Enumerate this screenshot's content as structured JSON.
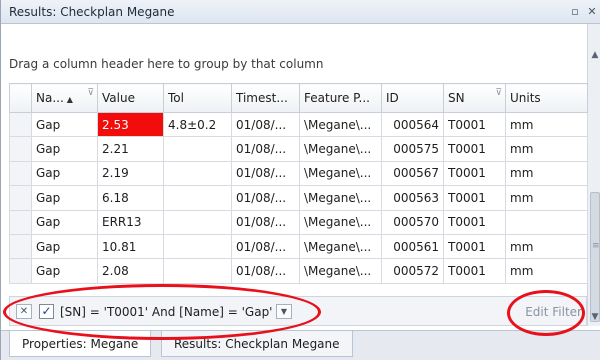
{
  "window": {
    "title": "Results: Checkplan Megane",
    "pin_icon": "dock-icon",
    "close_icon": "close-icon"
  },
  "group_panel": {
    "hint": "Drag a column header here to group by that column"
  },
  "grid": {
    "columns": [
      {
        "label": "Na...",
        "sort": "ascending",
        "filter": true
      },
      {
        "label": "Value",
        "filter": false
      },
      {
        "label": "Tol",
        "filter": false
      },
      {
        "label": "Timest...",
        "filter": false
      },
      {
        "label": "Feature P...",
        "filter": false
      },
      {
        "label": "ID",
        "filter": false
      },
      {
        "label": "SN",
        "filter": true
      },
      {
        "label": "Units",
        "filter": false
      }
    ],
    "rows": [
      {
        "name": "Gap",
        "value": "2.53",
        "tol": "4.8±0.2",
        "timestamp": "01/08/...",
        "feature": "\\Megane\\...",
        "id": "000564",
        "sn": "T0001",
        "units": "mm",
        "alert": true
      },
      {
        "name": "Gap",
        "value": "2.21",
        "tol": "",
        "timestamp": "01/08/...",
        "feature": "\\Megane\\...",
        "id": "000575",
        "sn": "T0001",
        "units": "mm",
        "alert": false
      },
      {
        "name": "Gap",
        "value": "2.19",
        "tol": "",
        "timestamp": "01/08/...",
        "feature": "\\Megane\\...",
        "id": "000567",
        "sn": "T0001",
        "units": "mm",
        "alert": false
      },
      {
        "name": "Gap",
        "value": "6.18",
        "tol": "",
        "timestamp": "01/08/...",
        "feature": "\\Megane\\...",
        "id": "000563",
        "sn": "T0001",
        "units": "mm",
        "alert": false
      },
      {
        "name": "Gap",
        "value": "ERR13",
        "tol": "",
        "timestamp": "01/08/...",
        "feature": "\\Megane\\...",
        "id": "000570",
        "sn": "T0001",
        "units": "",
        "alert": false
      },
      {
        "name": "Gap",
        "value": "10.81",
        "tol": "",
        "timestamp": "01/08/...",
        "feature": "\\Megane\\...",
        "id": "000561",
        "sn": "T0001",
        "units": "mm",
        "alert": false
      },
      {
        "name": "Gap",
        "value": "2.08",
        "tol": "",
        "timestamp": "01/08/...",
        "feature": "\\Megane\\...",
        "id": "000572",
        "sn": "T0001",
        "units": "mm",
        "alert": false
      }
    ]
  },
  "filter_bar": {
    "enabled": true,
    "expression": "[SN] = 'T0001' And [Name] = 'Gap'",
    "edit_label": "Edit Filter"
  },
  "tabs": [
    {
      "label": "Properties: Megane",
      "active": true
    },
    {
      "label": "Results: Checkplan Megane",
      "active": false
    }
  ],
  "colors": {
    "alert": "#f20c0c",
    "annotation": "#e8101a",
    "accent": "#1f3f8a"
  }
}
